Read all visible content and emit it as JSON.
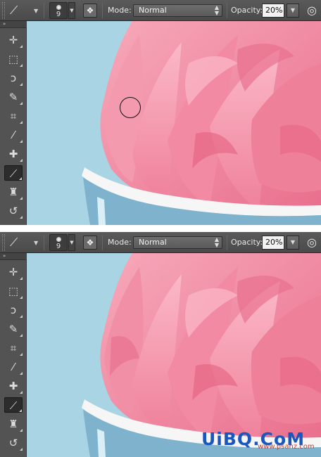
{
  "options_bar": {
    "brush_size": "9",
    "mode_label": "Mode:",
    "mode_value": "Normal",
    "opacity_label": "Opacity:",
    "opacity_value": "20%"
  },
  "toolbox": {
    "collapse_glyph": "»",
    "tools": [
      {
        "name": "move-tool",
        "glyph": "▸✛"
      },
      {
        "name": "marquee-tool",
        "glyph": "⬚"
      },
      {
        "name": "lasso-tool",
        "glyph": "ↄ"
      },
      {
        "name": "quick-selection-tool",
        "glyph": "✎"
      },
      {
        "name": "crop-tool",
        "glyph": "⌗"
      },
      {
        "name": "eyedropper-tool",
        "glyph": "⁄"
      },
      {
        "name": "healing-brush-tool",
        "glyph": "✚"
      },
      {
        "name": "brush-tool",
        "glyph": "⟋"
      },
      {
        "name": "clone-stamp-tool",
        "glyph": "♜"
      },
      {
        "name": "history-brush-tool",
        "glyph": "↺"
      }
    ],
    "active_tool": "brush-tool"
  },
  "colors": {
    "canvas_background": "#a9d4e4",
    "frosting": "#f28fa6",
    "cup_rim": "#f5f5f5"
  },
  "watermark": {
    "logo": "UiBQ.CoM",
    "url": "www.psahz.com"
  }
}
